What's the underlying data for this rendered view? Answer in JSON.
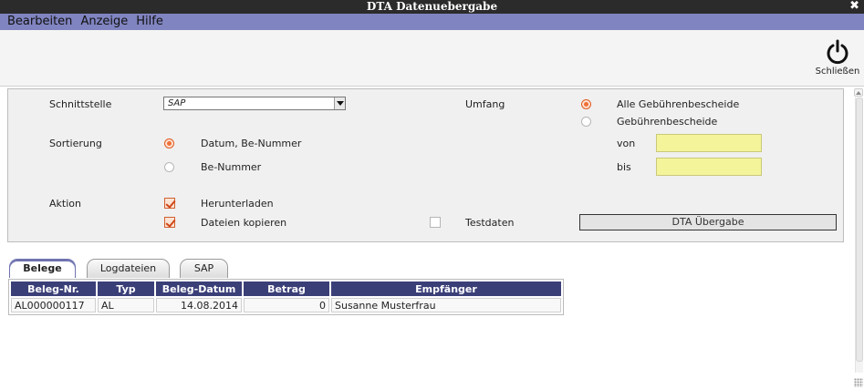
{
  "window": {
    "title": "DTA Datenuebergabe",
    "close_glyph": "✖"
  },
  "menu": {
    "items": [
      "Bearbeiten",
      "Anzeige",
      "Hilfe"
    ]
  },
  "toolbar": {
    "close_label": "Schließen",
    "close_icon": "power-icon"
  },
  "form": {
    "schnittstelle_label": "Schnittstelle",
    "schnittstelle_value": "SAP",
    "umfang_label": "Umfang",
    "umfang_options": [
      {
        "label": "Alle Gebührenbescheide",
        "checked": true
      },
      {
        "label": "Gebührenbescheide",
        "checked": false
      }
    ],
    "sortierung_label": "Sortierung",
    "sortierung_options": [
      {
        "label": "Datum, Be-Nummer",
        "checked": true
      },
      {
        "label": "Be-Nummer",
        "checked": false
      }
    ],
    "von_label": "von",
    "von_value": "",
    "bis_label": "bis",
    "bis_value": "",
    "aktion_label": "Aktion",
    "aktion_options": [
      {
        "label": "Herunterladen",
        "checked": true
      },
      {
        "label": "Dateien kopieren",
        "checked": true
      }
    ],
    "testdaten_label": "Testdaten",
    "testdaten_checked": false,
    "dta_button": "DTA Übergabe"
  },
  "tabs": [
    {
      "label": "Belege",
      "active": true
    },
    {
      "label": "Logdateien",
      "active": false
    },
    {
      "label": "SAP",
      "active": false
    }
  ],
  "table": {
    "columns": [
      "Beleg-Nr.",
      "Typ",
      "Beleg-Datum",
      "Betrag",
      "Empfänger"
    ],
    "rows": [
      [
        "AL000000117",
        "AL",
        "14.08.2014",
        "0",
        "Susanne Musterfrau"
      ]
    ]
  },
  "colors": {
    "menubar": "#8084c0",
    "header": "#3b3f78",
    "accent": "#f07037",
    "input_bg": "#f4f49a"
  }
}
